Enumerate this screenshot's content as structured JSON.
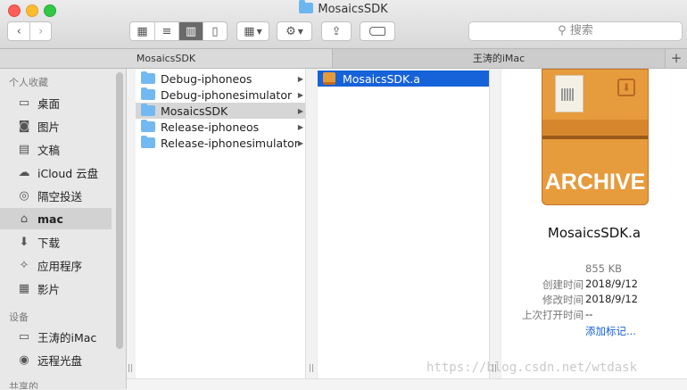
{
  "window": {
    "title": "MosaicsSDK"
  },
  "toolbar": {
    "view_icons": [
      "grid-icon",
      "list-icon",
      "columns-icon",
      "coverflow-icon"
    ],
    "search_placeholder": "搜索"
  },
  "tabs": [
    {
      "label": "MosaicsSDK"
    },
    {
      "label": "王涛的iMac"
    }
  ],
  "sidebar": {
    "favorites_header": "个人收藏",
    "favorites": [
      {
        "label": "桌面",
        "icon": "desktop-icon",
        "glyph": "▭"
      },
      {
        "label": "图片",
        "icon": "camera-icon",
        "glyph": "◙"
      },
      {
        "label": "文稿",
        "icon": "document-icon",
        "glyph": "▤"
      },
      {
        "label": "iCloud 云盘",
        "icon": "cloud-icon",
        "glyph": "☁"
      },
      {
        "label": "隔空投送",
        "icon": "airdrop-icon",
        "glyph": "◎"
      },
      {
        "label": "mac",
        "icon": "home-icon",
        "glyph": "⌂",
        "selected": true
      },
      {
        "label": "下载",
        "icon": "download-icon",
        "glyph": "⬇"
      },
      {
        "label": "应用程序",
        "icon": "apps-icon",
        "glyph": "✧"
      },
      {
        "label": "影片",
        "icon": "film-icon",
        "glyph": "▦"
      }
    ],
    "devices_header": "设备",
    "devices": [
      {
        "label": "王涛的iMac",
        "icon": "imac-icon",
        "glyph": "▭"
      },
      {
        "label": "远程光盘",
        "icon": "disc-icon",
        "glyph": "◉"
      }
    ],
    "shared_header": "共享的"
  },
  "column1": {
    "items": [
      {
        "label": "Debug-iphoneos"
      },
      {
        "label": "Debug-iphonesimulator"
      },
      {
        "label": "MosaicsSDK",
        "selected": true
      },
      {
        "label": "Release-iphoneos"
      },
      {
        "label": "Release-iphonesimulator"
      }
    ]
  },
  "column2": {
    "items": [
      {
        "label": "MosaicsSDK.a",
        "selected": true
      }
    ]
  },
  "preview": {
    "icon_text": "ARCHIVE",
    "file_name": "MosaicsSDK.a",
    "size": "855 KB",
    "created_label": "创建时间",
    "created_value": "2018/9/12",
    "modified_label": "修改时间",
    "modified_value": "2018/9/12",
    "last_opened_label": "上次打开时间",
    "last_opened_value": "--",
    "add_tags": "添加标记..."
  },
  "watermark": "https://blog.csdn.net/wtdask"
}
